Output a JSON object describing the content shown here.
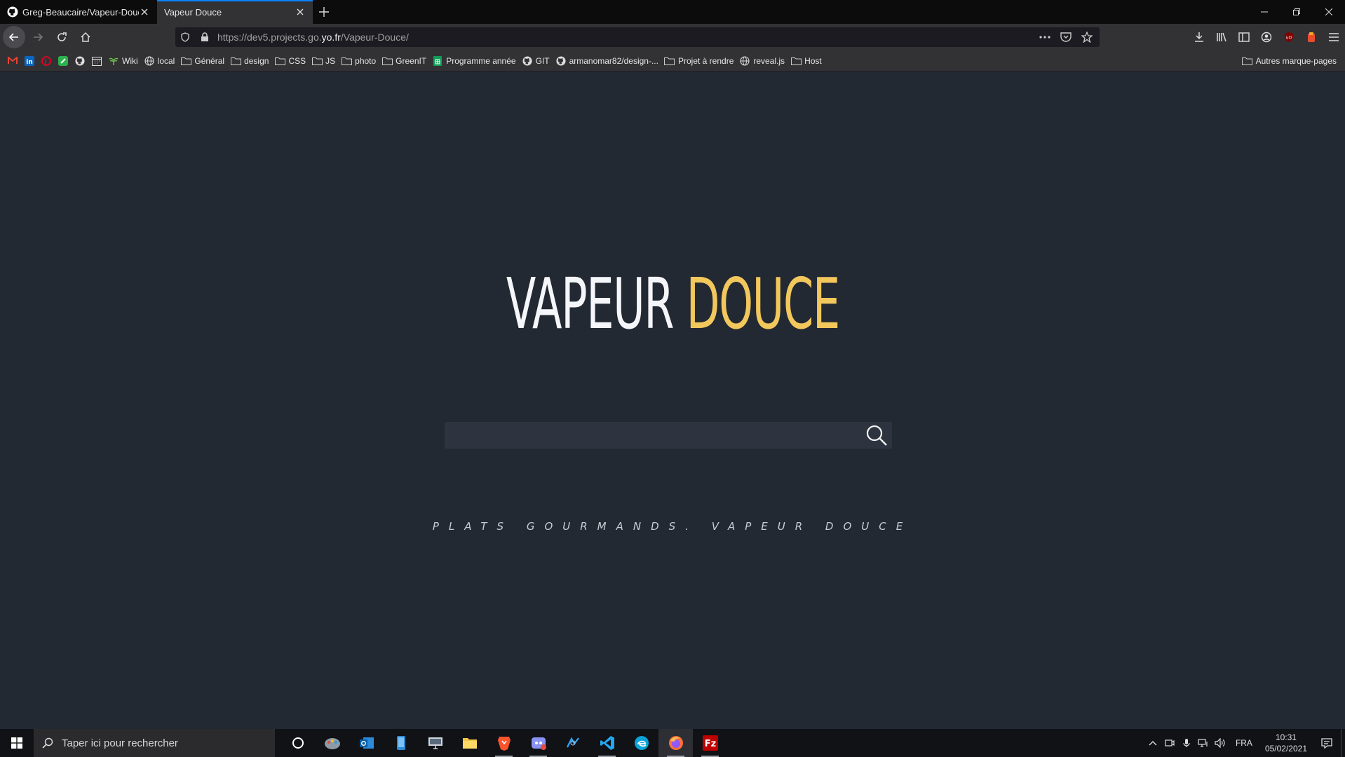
{
  "browser": {
    "tabs": [
      {
        "title": "Greg-Beaucaire/Vapeur-Douce",
        "icon": "github-icon",
        "active": false
      },
      {
        "title": "Vapeur Douce",
        "icon": "",
        "active": true
      }
    ],
    "url": {
      "prefix": "https://dev5.projects.go.",
      "host": "yo.fr",
      "path": "/Vapeur-Douce/"
    },
    "bookmarks": [
      {
        "label": "",
        "icon": "gmail-icon"
      },
      {
        "label": "",
        "icon": "linkedin-icon"
      },
      {
        "label": "",
        "icon": "pinterest-icon"
      },
      {
        "label": "",
        "icon": "feedly-icon"
      },
      {
        "label": "",
        "icon": "github-icon"
      },
      {
        "label": "",
        "icon": "calendar-icon"
      },
      {
        "label": "Wiki",
        "icon": "wiki-icon"
      },
      {
        "label": "local",
        "icon": "globe-icon"
      },
      {
        "label": "Général",
        "icon": "folder-icon"
      },
      {
        "label": "design",
        "icon": "folder-icon"
      },
      {
        "label": "CSS",
        "icon": "folder-icon"
      },
      {
        "label": "JS",
        "icon": "folder-icon"
      },
      {
        "label": "photo",
        "icon": "folder-icon"
      },
      {
        "label": "GreenIT",
        "icon": "folder-icon"
      },
      {
        "label": "Programme année",
        "icon": "sheets-icon"
      },
      {
        "label": "GIT",
        "icon": "github-icon"
      },
      {
        "label": "armanomar82/design-...",
        "icon": "github-icon"
      },
      {
        "label": "Projet à rendre",
        "icon": "folder-icon"
      },
      {
        "label": "reveal.js",
        "icon": "globe-icon"
      },
      {
        "label": "Host",
        "icon": "folder-icon"
      }
    ],
    "other_bookmarks": "Autres marque-pages"
  },
  "page": {
    "brand_first": "VAPEUR",
    "brand_second": "DOUCE",
    "search_value": "",
    "search_placeholder": "",
    "tagline": "PLATS GOURMANDS. VAPEUR DOUCE",
    "colors": {
      "background": "#232933",
      "accent": "#f2c75c",
      "search_bg": "#2e343f"
    }
  },
  "taskbar": {
    "search_placeholder": "Taper ici pour rechercher",
    "apps": [
      "cortana-icon",
      "paint-icon",
      "outlook-icon",
      "phone-icon",
      "remote-desktop-icon",
      "file-explorer-icon",
      "brave-icon",
      "discord-icon",
      "photoshop-icon",
      "vscode-icon",
      "edge-icon",
      "firefox-icon",
      "filezilla-icon"
    ],
    "language": "FRA",
    "time": "10:31",
    "date": "05/02/2021"
  }
}
